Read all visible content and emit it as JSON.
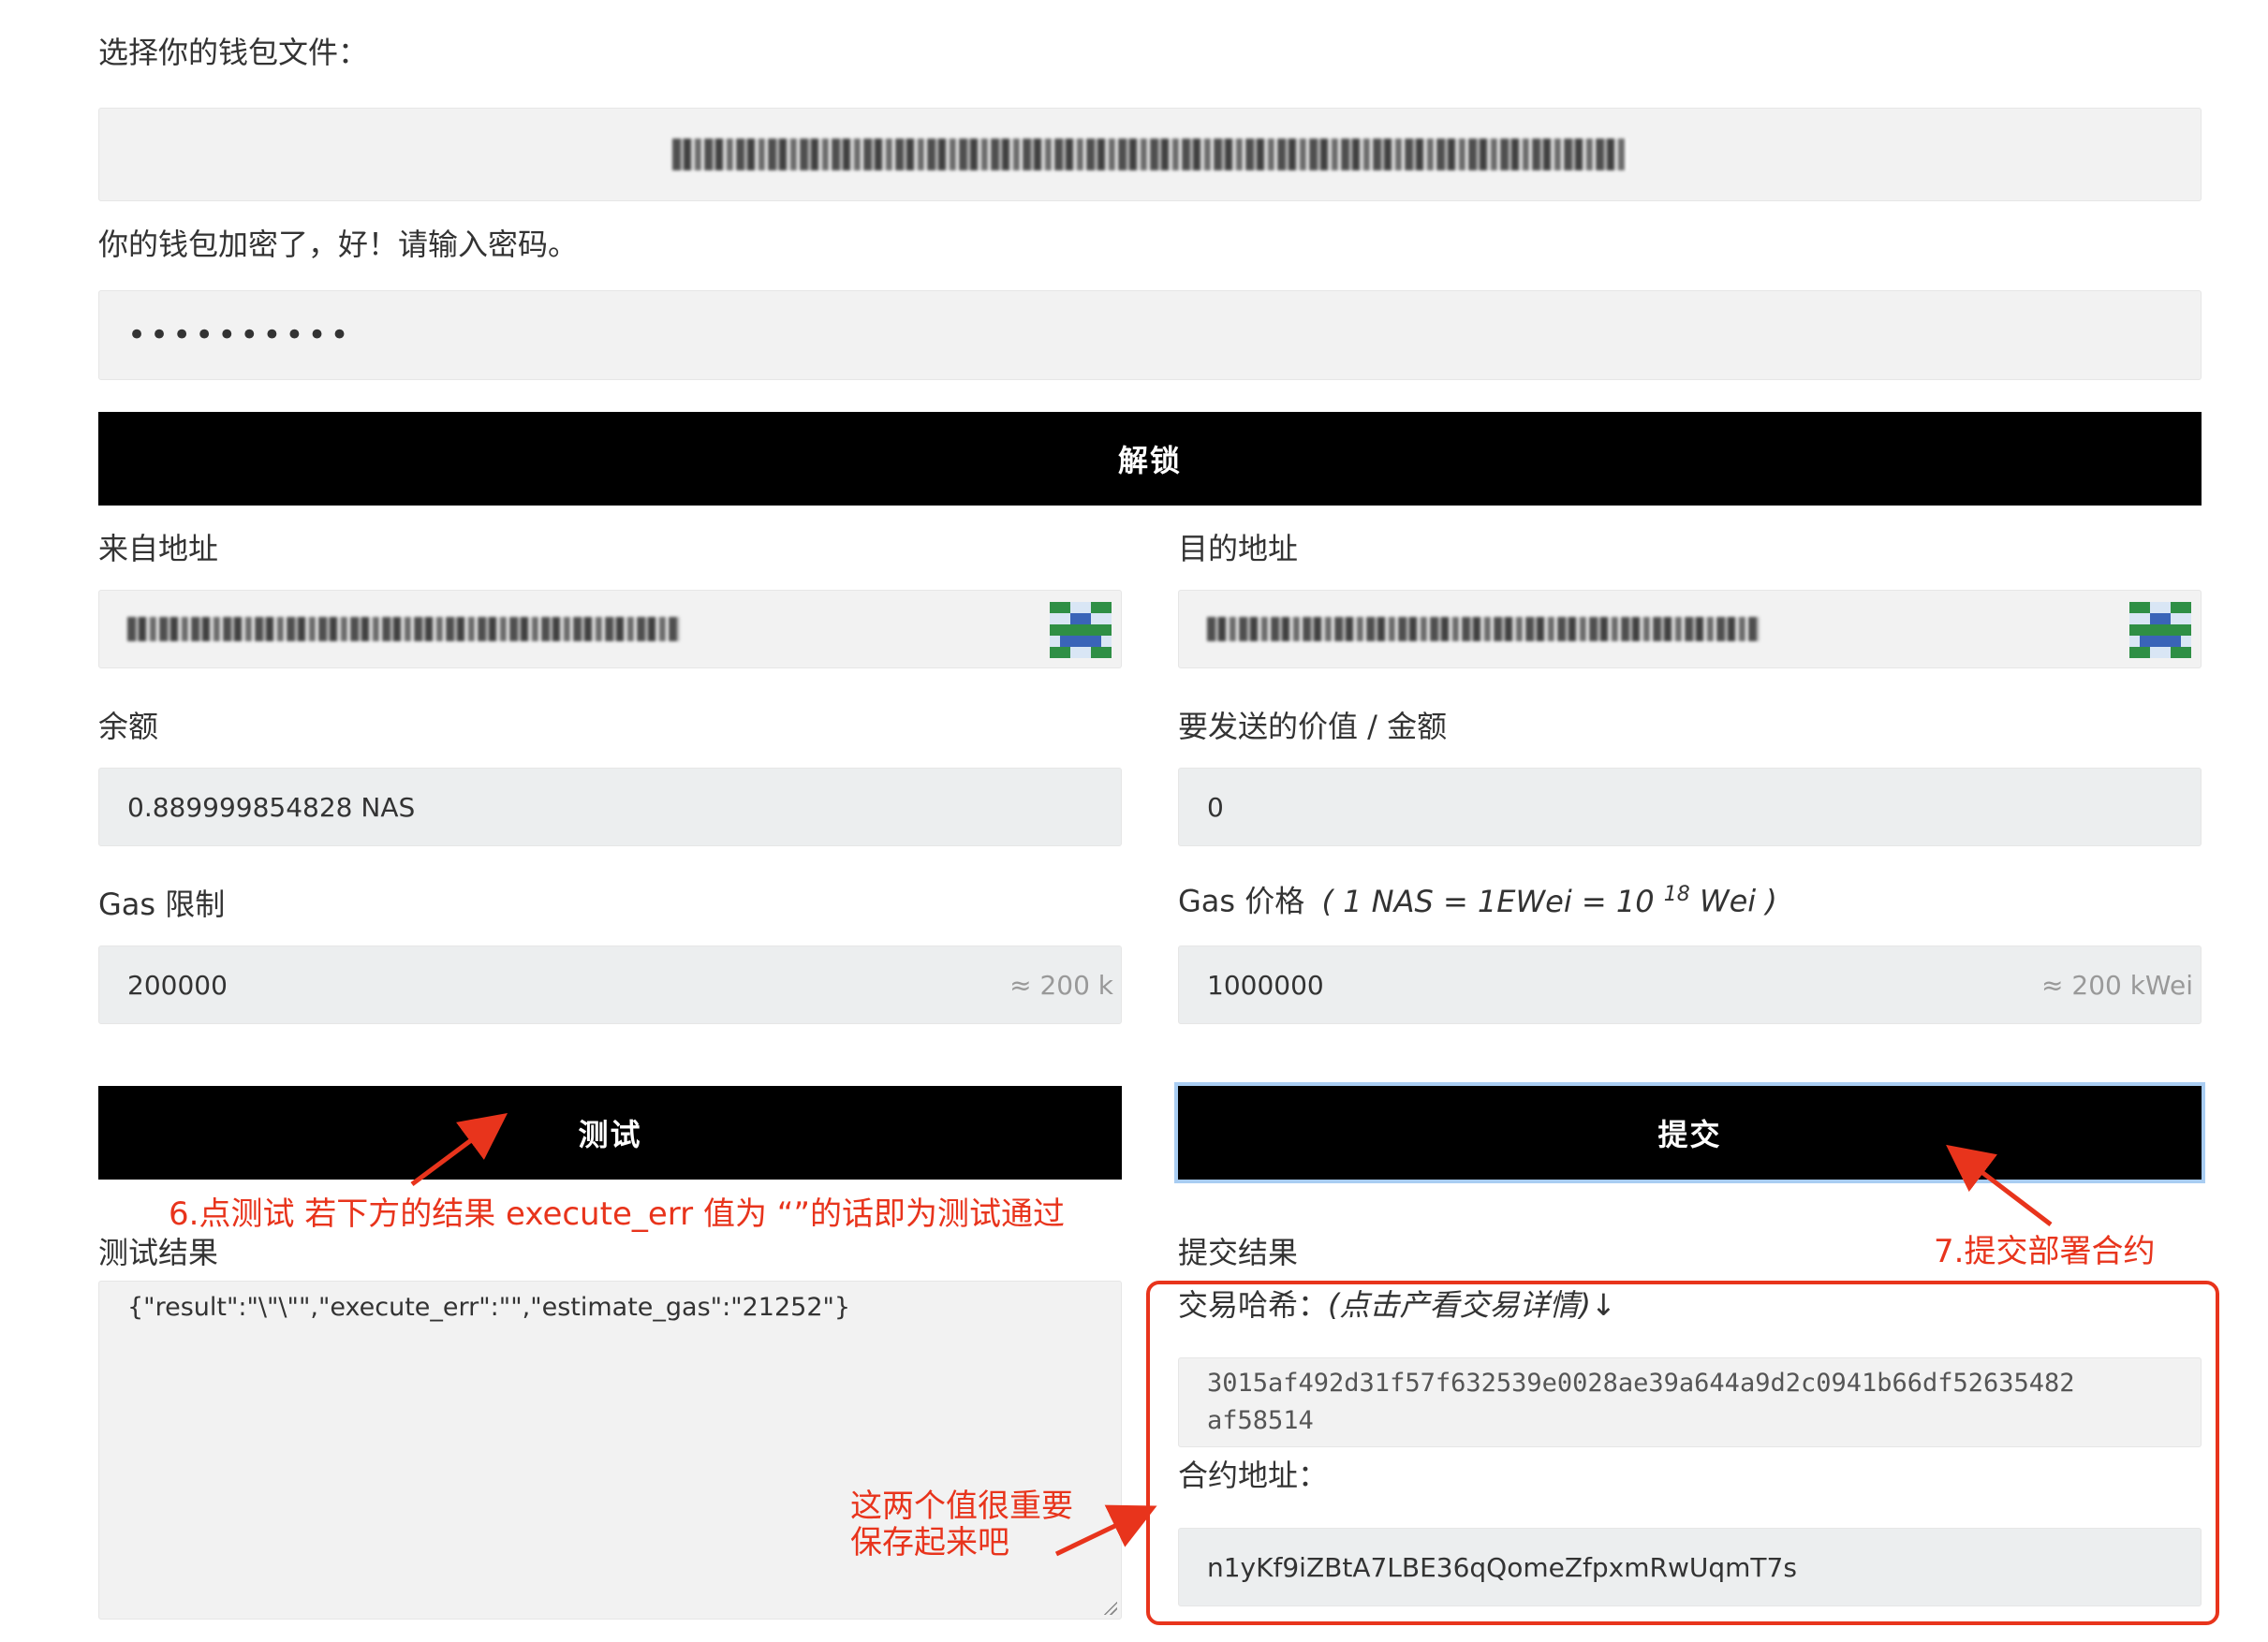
{
  "wallet": {
    "choose_label": "选择你的钱包文件：",
    "encrypted_label": "你的钱包加密了，好！请输入密码。",
    "password_value": "••••••••••",
    "unlock_button": "解锁"
  },
  "form": {
    "from_label": "来自地址",
    "to_label": "目的地址",
    "balance_label": "余额",
    "balance_value": "0.889999854828 NAS",
    "value_label": "要发送的价值 / 金额",
    "value_value": "0",
    "gas_limit_label": "Gas 限制",
    "gas_limit_value": "200000",
    "gas_limit_hint": "≈ 200 k",
    "gas_price_label_prefix": "Gas 价格",
    "gas_price_formula_pre": "( 1 NAS = 1EWei = 10",
    "gas_price_formula_exp": "18",
    "gas_price_formula_post": "Wei )",
    "gas_price_value": "1000000",
    "gas_price_hint": "≈ 200 kWei",
    "test_button": "测试",
    "submit_button": "提交"
  },
  "results": {
    "test_result_label": "测试结果",
    "test_result_value": "{\"result\":\"\\\"\\\"\",\"execute_err\":\"\",\"estimate_gas\":\"21252\"}",
    "submit_result_label": "提交结果",
    "tx_hash_label_plain": "交易哈希：",
    "tx_hash_label_italic": "(点击产看交易详情)↓",
    "tx_hash_line1": "3015af492d31f57f632539e0028ae39a644a9d2c0941b66df52635482",
    "tx_hash_line2": "af58514",
    "contract_address_label": "合约地址：",
    "contract_address_value": "n1yKf9iZBtA7LBE36qQomeZfpxmRwUqmT7s"
  },
  "annotations": {
    "note_test": "6.点测试 若下方的结果 execute_err 值为 “”的话即为测试通过",
    "note_submit": "7.提交部署合约",
    "note_save_line1": "这两个值很重要",
    "note_save_line2": "保存起来吧"
  },
  "colors": {
    "annotation_red": "#e8341c",
    "button_black": "#000000",
    "field_bg": "#f2f2f2"
  },
  "icons": {
    "from_identicon": "identicon",
    "to_identicon": "identicon"
  }
}
